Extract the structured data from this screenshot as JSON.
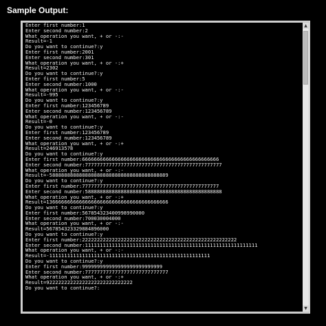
{
  "page": {
    "caption": "Sample Output:"
  },
  "scrollbar": {
    "up_glyph": "▲",
    "down_glyph": "▼"
  },
  "console": {
    "lines": [
      "Enter first number:1",
      "Enter second number:2",
      "What operation you want, + or -:-",
      "Result=-1",
      "Do you want to continue?:y",
      "Enter first number:2001",
      "Enter second number:301",
      "What operation you want, + or -:+",
      "Result=2302",
      "Do you want to continue?:y",
      "Enter first number:5",
      "Enter second number:1000",
      "What operation you want, + or -:-",
      "Result=-995",
      "Do you want to continue?:y",
      "Enter first number:123456789",
      "Enter second number:123456789",
      "What operation you want, + or -:-",
      "Result=-0",
      "Do you want to continue?:y",
      "Enter first number:123456789",
      "Enter second number:123456789",
      "What operation you want, + or -:+",
      "Result=246913578",
      "Do you want to continue?:y",
      "Enter first number:6666666666666666666666666666666666666666666666",
      "Enter second number:7777777777777777777777777777777777777777777777",
      "What operation you want, + or -:-",
      "Result=-5888888888888888888888888888888888888889",
      "Do you want to continue?:y",
      "Enter first number:7777777777777777777777777777777777777777777777",
      "Enter second number:5888888888888888888888888888888888888888888888",
      "What operation you want, + or -:+",
      "Result=13666666666666666666666666666666666666666",
      "Do you want to continue?:y",
      "Enter first number:567854323400998990000",
      "Enter second number:700030004000",
      "What operation you want, + or -:-",
      "Result=567854323329884896000",
      "Do you want to continue?:y",
      "Enter first number:2222222222222222222222222222222222222222222222222222",
      "Enter second number:1111111111111111111111111111111111111111111111111111111111",
      "What operation you want, + or -:-",
      "Result=-111111111111111111111111111111111111111111111111111111",
      "Do you want to continue?:y",
      "Enter first number:999999999999999999999999999",
      "Enter second number:7777777777777777777777777777",
      "What operation you want, + or -:+",
      "Result=92222222222222222222222222222",
      "Do you want to continue?:"
    ]
  }
}
